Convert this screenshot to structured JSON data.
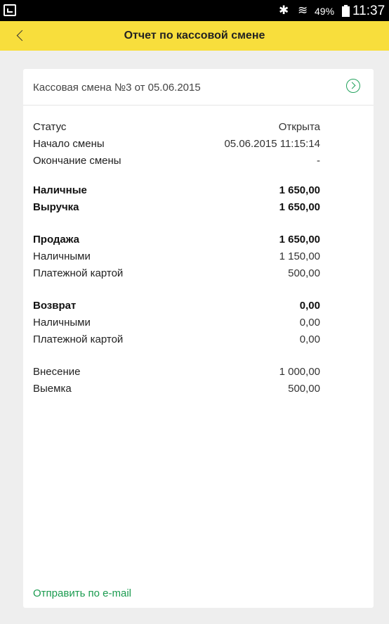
{
  "status_bar": {
    "battery": "49%",
    "time": "11:37",
    "bluetooth_icon": "bluetooth-icon",
    "wifi_icon": "wifi-icon"
  },
  "toolbar": {
    "title": "Отчет по кассовой смене",
    "back_icon": "chevron-left-icon"
  },
  "card": {
    "title": "Кассовая смена №3 от 05.06.2015",
    "nav_icon": "chevron-right-circle-icon",
    "rows": [
      {
        "label": "Статус",
        "value": "Открыта",
        "bold": false
      },
      {
        "label": "Начало смены",
        "value": "05.06.2015 11:15:14",
        "bold": false
      },
      {
        "label": "Окончание смены",
        "value": "-",
        "bold": false
      },
      {
        "label": "Наличные",
        "value": "1 650,00",
        "bold": true
      },
      {
        "label": "Выручка",
        "value": "1 650,00",
        "bold": true
      },
      {
        "label": "Продажа",
        "value": "1 650,00",
        "bold": true
      },
      {
        "label": "Наличными",
        "value": "1 150,00",
        "bold": false
      },
      {
        "label": "Платежной картой",
        "value": "500,00",
        "bold": false
      },
      {
        "label": "Возврат",
        "value": "0,00",
        "bold": true
      },
      {
        "label": "Наличными",
        "value": "0,00",
        "bold": false
      },
      {
        "label": "Платежной картой",
        "value": "0,00",
        "bold": false
      },
      {
        "label": "Внесение",
        "value": "1 000,00",
        "bold": false
      },
      {
        "label": "Выемка",
        "value": "500,00",
        "bold": false
      }
    ],
    "send_email": "Отправить по e-mail"
  },
  "colors": {
    "toolbar": "#f8de3c",
    "accent_green": "#1a9b4f"
  }
}
